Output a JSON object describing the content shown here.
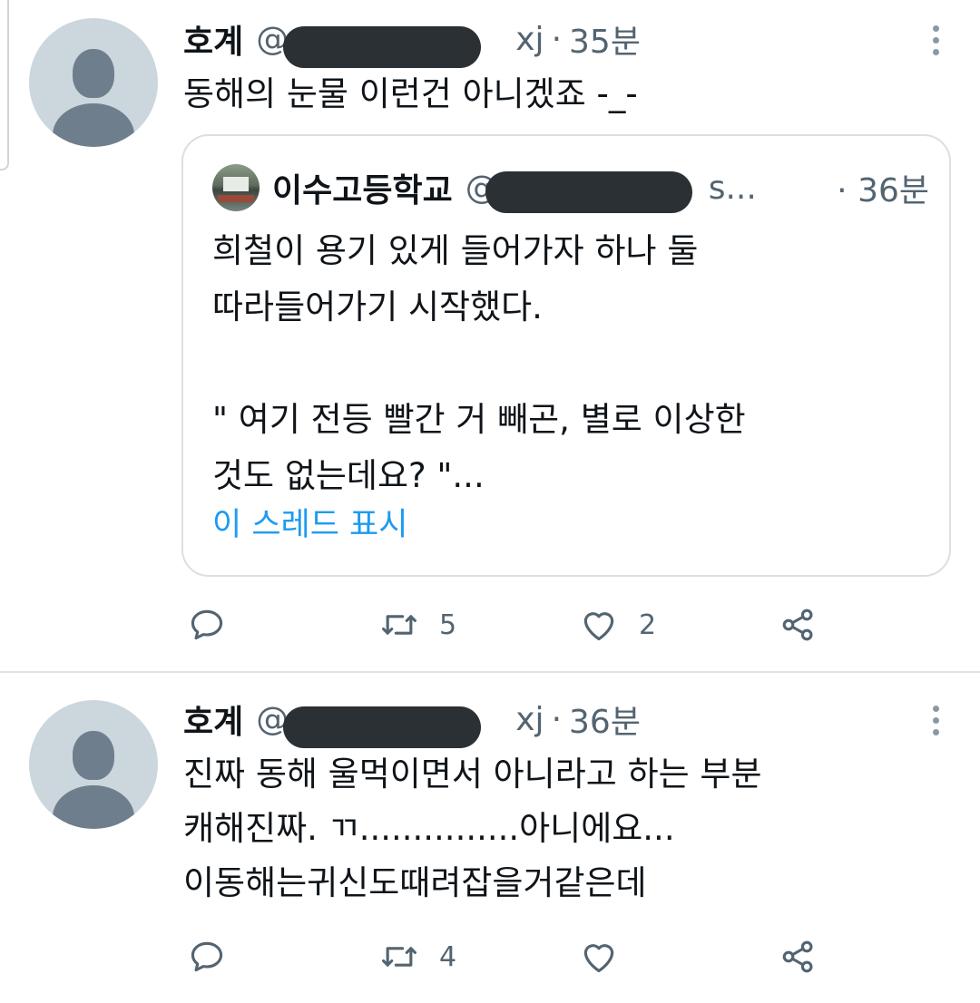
{
  "tweets": [
    {
      "author": {
        "name": "호계",
        "handle_prefix": "@",
        "handle_suffix": "xj"
      },
      "separator": "·",
      "time": "35분",
      "text": "동해의 눈물 이런건 아니겠죠 -_-",
      "quote": {
        "author": {
          "name": "이수고등학교",
          "handle_prefix": "@",
          "handle_suffix": "s..."
        },
        "separator": "·",
        "time": "36분",
        "text": "희철이 용기 있게 들어가자 하나 둘\n따라들어가기 시작했다.\n\n\" 여기 전등 빨간 거 빼곤, 별로 이상한\n것도 없는데요? \"...",
        "show_thread": "이 스레드 표시"
      },
      "actions": {
        "reply_count": "",
        "retweet_count": "5",
        "like_count": "2"
      }
    },
    {
      "author": {
        "name": "호계",
        "handle_prefix": "@",
        "handle_suffix": "xj"
      },
      "separator": "·",
      "time": "36분",
      "text": "진짜 동해 울먹이면서 아니라고 하는 부분\n캐해진짜. ㄲ...............아니에요...\n이동해는귀신도때려잡을거같은데",
      "actions": {
        "reply_count": "",
        "retweet_count": "4",
        "like_count": ""
      }
    }
  ],
  "icons": {
    "reply": "reply-icon",
    "retweet": "retweet-icon",
    "like": "heart-icon",
    "share": "share-icon",
    "more": "more-vertical-icon"
  },
  "colors": {
    "link": "#1d9bf0",
    "secondary_text": "#536471",
    "divider": "#dde3e8"
  }
}
